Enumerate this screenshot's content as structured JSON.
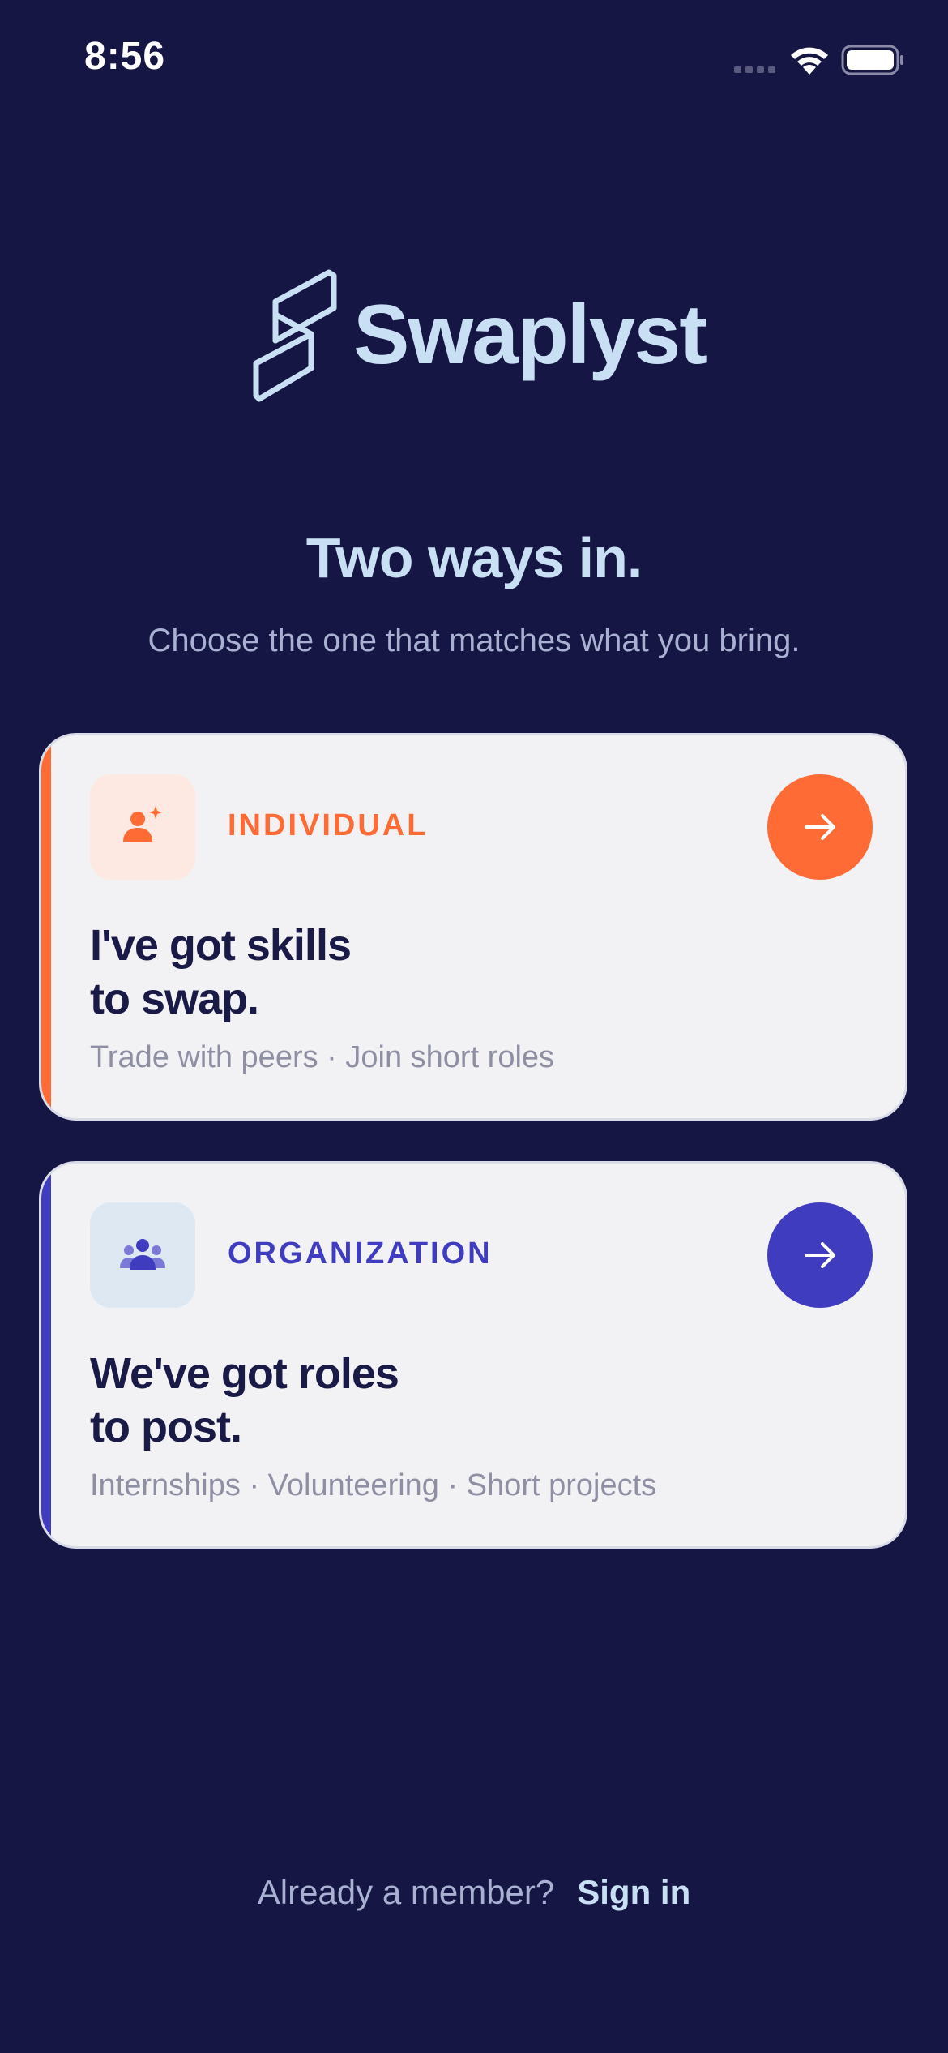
{
  "status_bar": {
    "time": "8:56",
    "icons": [
      "signal-icon",
      "wifi-icon",
      "battery-icon"
    ]
  },
  "brand": {
    "name": "Swaplyst",
    "logo_icon": "swaplyst-logo-icon",
    "color": "#c9e0f4"
  },
  "headline": "Two ways in.",
  "subheadline": "Choose the one that matches what you bring.",
  "cards": [
    {
      "tag": "INDIVIDUAL",
      "icon": "person-sparkle-icon",
      "title_line1": "I've got skills",
      "title_line2": "to swap.",
      "description": "Trade with peers · Join short roles",
      "accent_color": "#ff6b35",
      "action_icon": "arrow-right-icon"
    },
    {
      "tag": "ORGANIZATION",
      "icon": "group-icon",
      "title_line1": "We've got roles",
      "title_line2": "to post.",
      "description": "Internships · Volunteering · Short projects",
      "accent_color": "#3f3cc0",
      "action_icon": "arrow-right-icon"
    }
  ],
  "footer": {
    "prompt": "Already a member?",
    "link": "Sign in"
  },
  "colors": {
    "background": "#161644",
    "card_background": "#f2f2f5",
    "text_dark": "#1a1a46",
    "text_muted": "#8e8fa3"
  }
}
